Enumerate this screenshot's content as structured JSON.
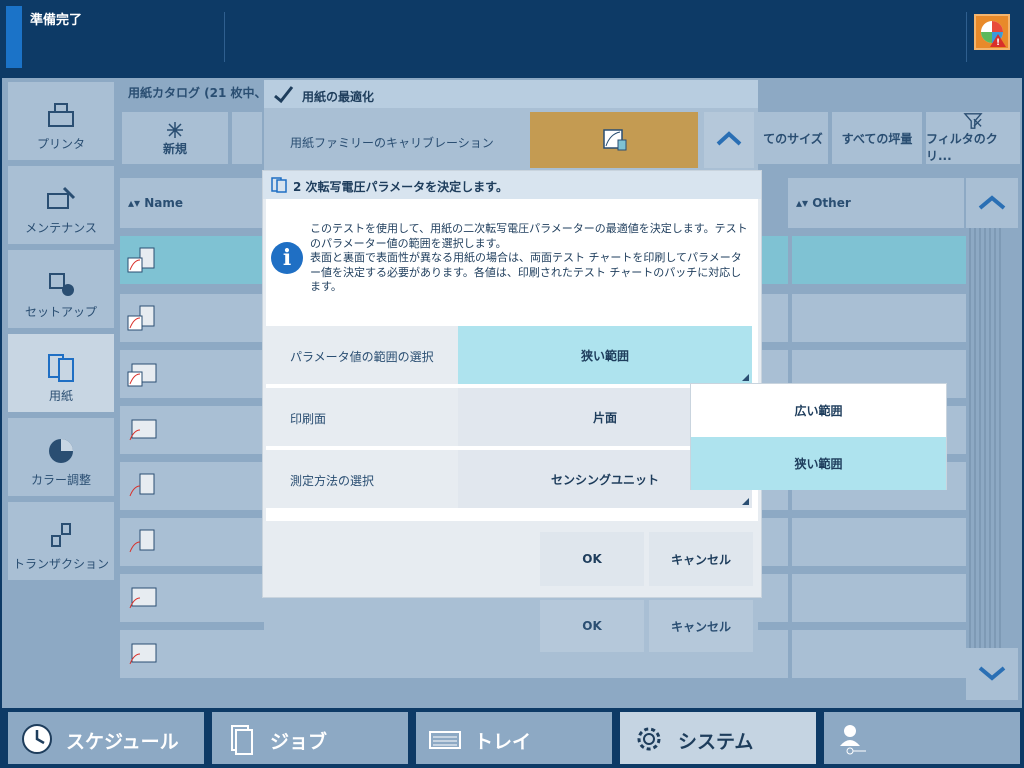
{
  "status": {
    "text": "準備完了"
  },
  "sidebar": {
    "items": [
      {
        "label": "プリンタ"
      },
      {
        "label": "メンテナンス"
      },
      {
        "label": "セットアップ"
      },
      {
        "label": "用紙"
      },
      {
        "label": "カラー調整"
      },
      {
        "label": "トランザクション"
      }
    ]
  },
  "catalog": {
    "title": "用紙カタログ (21 枚中、"
  },
  "toolbar": {
    "new_label": "新規",
    "all_sizes": "てのサイズ",
    "all_weights": "すべての坪量",
    "filter_clear": "フィルタのクリ..."
  },
  "columns": {
    "name": "Name",
    "other": "Other"
  },
  "back_dialog": {
    "title": "用紙の最適化",
    "calibration_label": "用紙ファミリーのキャリブレーション",
    "ok": "OK",
    "cancel": "キャンセル"
  },
  "dialog": {
    "title": "2 次転写電圧パラメータを決定します。",
    "info": "このテストを使用して、用紙の二次転写電圧パラメーターの最適値を決定します。テストのパラメーター値の範囲を選択します。\n表面と裏面で表面性が異なる用紙の場合は、両面テスト チャートを印刷してパラメーター値を決定する必要があります。各値は、印刷されたテスト チャートのパッチに対応します。",
    "rows": [
      {
        "label": "パラメータ値の範囲の選択",
        "value": "狭い範囲"
      },
      {
        "label": "印刷面",
        "value": "片面"
      },
      {
        "label": "測定方法の選択",
        "value": "センシングユニット"
      }
    ],
    "ok": "OK",
    "cancel": "キャンセル"
  },
  "dropdown": {
    "options": [
      {
        "label": "広い範囲"
      },
      {
        "label": "狭い範囲"
      }
    ]
  },
  "bottom": {
    "tabs": [
      {
        "label": "スケジュール"
      },
      {
        "label": "ジョブ"
      },
      {
        "label": "トレイ"
      },
      {
        "label": "システム"
      },
      {
        "label": ""
      }
    ]
  }
}
